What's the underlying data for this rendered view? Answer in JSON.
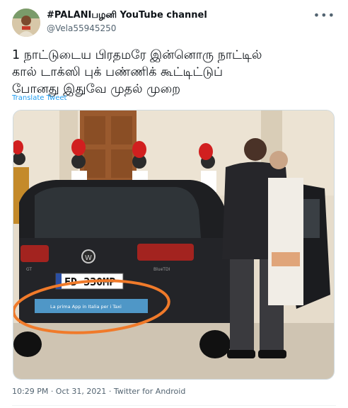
{
  "tweet": {
    "display_name": "#PALANIபழனி YouTube channel",
    "handle": "@Vela55945250",
    "more_icon": "more-horizontal-icon",
    "text_lines": [
      "1 நாட்டுடைய பிரதமரே இன்னொரு நாட்டில்",
      "கால் டாக்ஸி புக் பண்ணிக் கூட்டிட்டுப்",
      "போனது இதுவே முதல் முறை"
    ],
    "translate_label": "Translate Tweet",
    "timestamp": "10:29 PM · Oct 31, 2021",
    "source": "Twitter for Android",
    "photo": {
      "plate": "FD 330MP",
      "sticker_text": "La prima App in Italia per i Taxi",
      "car_badge_left": "GT",
      "car_badge_right": "BlueTDI"
    }
  },
  "colors": {
    "link": "#1d9bf0",
    "secondary": "#536471",
    "text": "#0f1419",
    "highlight_circle": "#f07a2a"
  }
}
